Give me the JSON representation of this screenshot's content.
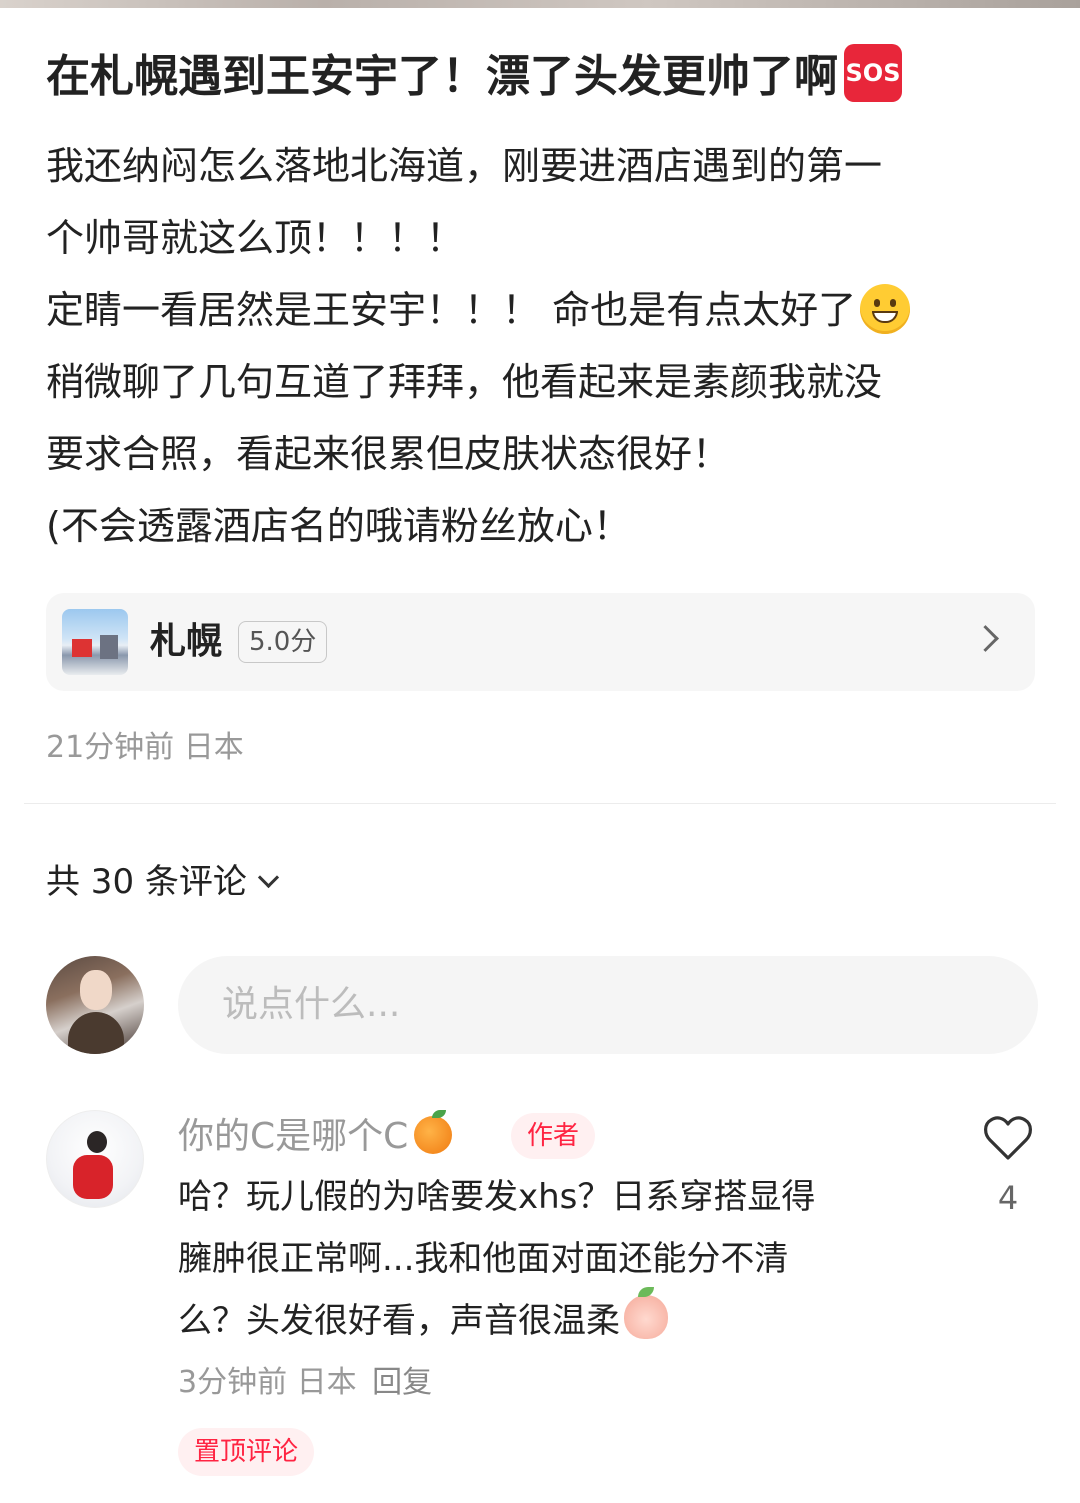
{
  "post": {
    "title": "在札幌遇到王安宇了！漂了头发更帅了啊",
    "title_badge": "SOS",
    "body": [
      "我还纳闷怎么落地北海道，刚要进酒店遇到的第一",
      "个帅哥就这么顶！！！！",
      "定睛一看居然是王安宇！！！ 命也是有点太好了",
      "稍微聊了几句互道了拜拜，他看起来是素颜我就没",
      "要求合照，看起来很累但皮肤状态很好！",
      "(不会透露酒店名的哦请粉丝放心！"
    ],
    "location": {
      "name": "札幌",
      "score": "5.0分"
    },
    "meta": "21分钟前 日本"
  },
  "comments_section": {
    "count_label": "共 30 条评论",
    "input_placeholder": "说点什么..."
  },
  "comment": {
    "username": "你的C是哪个C",
    "author_tag": "作者",
    "text": [
      "哈？玩儿假的为啥要发xhs？日系穿搭显得",
      "臃肿很正常啊...我和他面对面还能分不清",
      "么？头发很好看，声音很温柔"
    ],
    "meta": "3分钟前 日本",
    "reply_label": "回复",
    "pinned_tag": "置顶评论",
    "like_count": "4"
  },
  "colors": {
    "accent": "#ff2442",
    "muted": "#999999",
    "card_bg": "#f6f6f6"
  }
}
